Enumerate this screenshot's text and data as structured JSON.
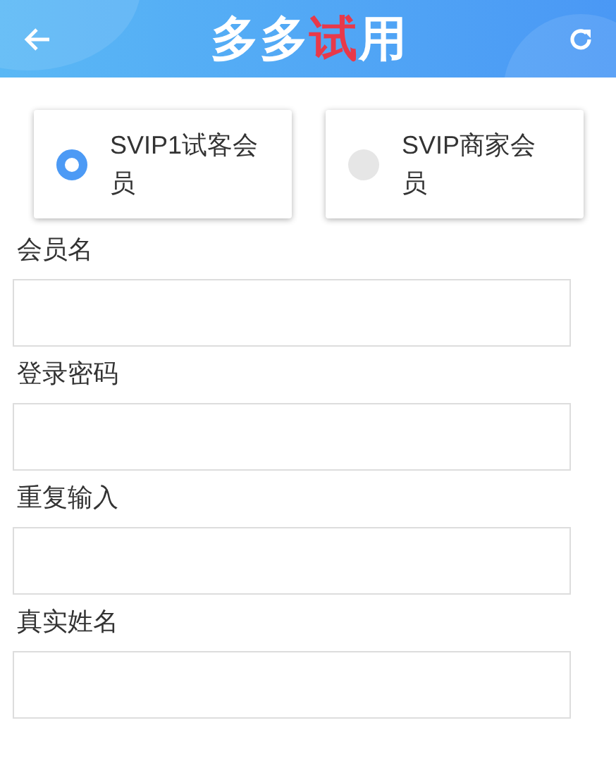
{
  "header": {
    "title": [
      {
        "text": "多多",
        "accent": false
      },
      {
        "text": "试",
        "accent": true
      },
      {
        "text": "用",
        "accent": false
      }
    ]
  },
  "member_types": [
    {
      "label": "SVIP1试客会员",
      "selected": true
    },
    {
      "label": "SVIP商家会员",
      "selected": false
    }
  ],
  "fields": [
    {
      "label": "会员名"
    },
    {
      "label": "登录密码"
    },
    {
      "label": "重复输入"
    },
    {
      "label": "真实姓名"
    }
  ]
}
